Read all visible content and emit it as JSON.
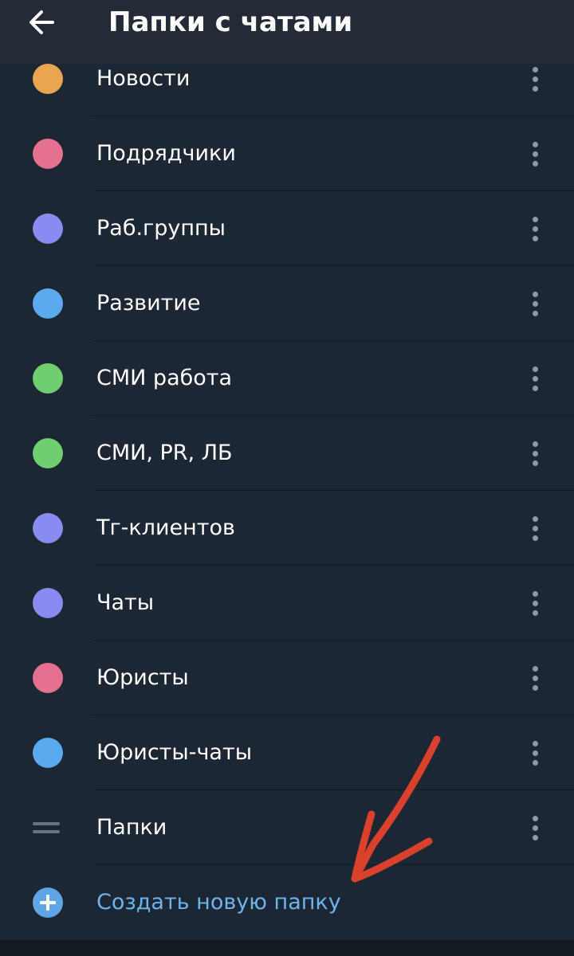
{
  "header": {
    "title": "Папки с чатами",
    "back_icon": "arrow-left-icon"
  },
  "folders": [
    {
      "name": "Новости",
      "color": "#e9a54f"
    },
    {
      "name": "Подрядчики",
      "color": "#e5708f"
    },
    {
      "name": "Раб.группы",
      "color": "#8a8af0"
    },
    {
      "name": "Развитие",
      "color": "#5ba9ef"
    },
    {
      "name": "СМИ работа",
      "color": "#6fcf6f"
    },
    {
      "name": "СМИ, PR, ЛБ",
      "color": "#6fcf6f"
    },
    {
      "name": "Тг-клиентов",
      "color": "#8a8af0"
    },
    {
      "name": "Чаты",
      "color": "#8a8af0"
    },
    {
      "name": "Юристы",
      "color": "#e5708f"
    },
    {
      "name": "Юристы-чаты",
      "color": "#5ba9ef"
    }
  ],
  "folders_row": {
    "name": "Папки",
    "icon": "drag-handle-icon"
  },
  "create_folder": {
    "label": "Создать новую папку",
    "icon": "plus-circle-icon",
    "color": "#6cb4ee"
  },
  "menu_icon": "more-vertical-icon",
  "annotation": {
    "icon": "red-arrow-annotation",
    "color": "#d9412c"
  },
  "colors": {
    "background": "#1d2733",
    "header": "#222b36",
    "divider": "#131a22",
    "text": "#ffffff"
  }
}
